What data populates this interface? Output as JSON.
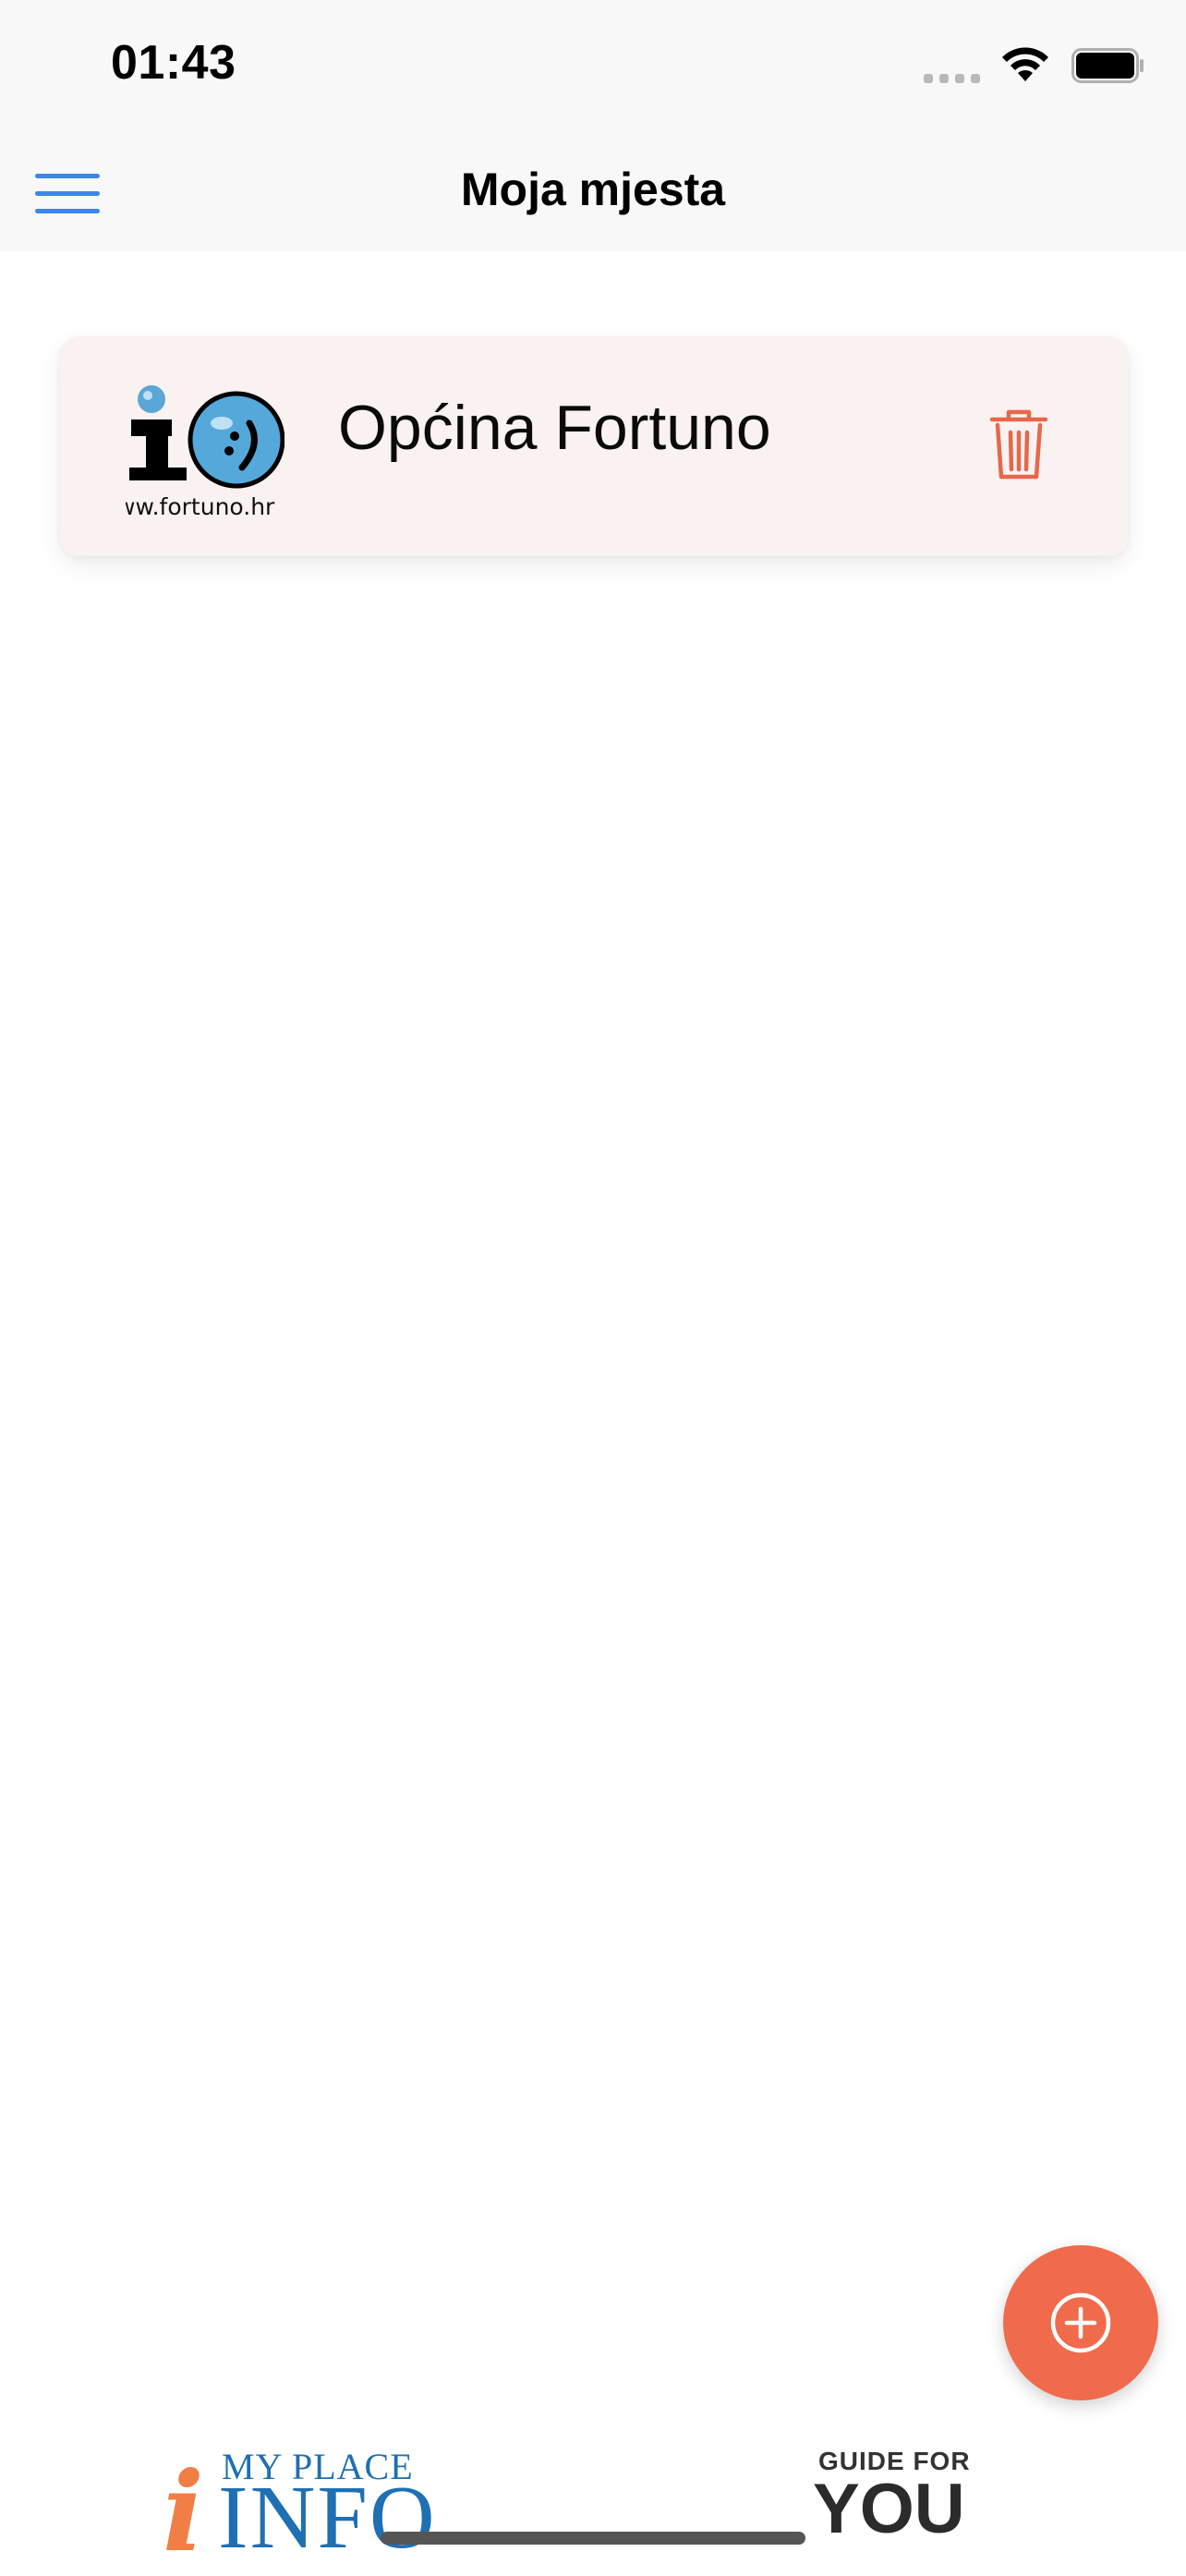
{
  "status_bar": {
    "time": "01:43",
    "icons": [
      "signal-icon",
      "wifi-icon",
      "battery-icon"
    ]
  },
  "header": {
    "title": "Moja mjesta",
    "menu_icon": "hamburger-menu-icon",
    "accent_color": "#3d86e6"
  },
  "places": [
    {
      "name": "Općina Fortuno",
      "logo_text": "ww.fortuno.hr",
      "delete_icon": "trash-icon"
    }
  ],
  "fab": {
    "icon": "plus-circle-icon",
    "color": "#ef6b4c"
  },
  "footer": {
    "brand_left": {
      "top": "MY PLACE",
      "bottom": "INFO",
      "letter": "i"
    },
    "brand_right": {
      "top": "GUIDE FOR",
      "bottom": "YOU"
    }
  },
  "colors": {
    "card_background": "#f9f2f0",
    "delete": "#e8674a",
    "brand_blue": "#1f6fb3",
    "brand_orange": "#ef7f45"
  }
}
